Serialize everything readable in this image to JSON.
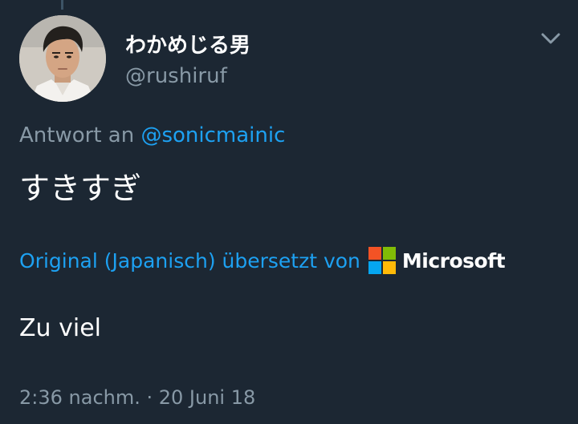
{
  "tweet": {
    "user": {
      "display_name": "わかめじる男",
      "handle": "@rushiruf",
      "avatar": "user-photo"
    },
    "reply_to": {
      "prefix": "Antwort an",
      "mention": "@sonicmainic"
    },
    "text": "すきすぎ",
    "translation": {
      "credit": "Original (Japanisch) übersetzt von",
      "provider": "Microsoft",
      "text": "Zu viel"
    },
    "timestamp": "2:36 nachm. · 20 Juni 18",
    "menu_icon": "chevron-down-icon"
  },
  "colors": {
    "background": "#1c2733",
    "secondary_text": "#8899a6",
    "link": "#1da1f2",
    "primary_text": "#ffffff",
    "ms_red": "#f35325",
    "ms_green": "#81bc06",
    "ms_blue": "#05a6f0",
    "ms_yellow": "#ffba08"
  }
}
